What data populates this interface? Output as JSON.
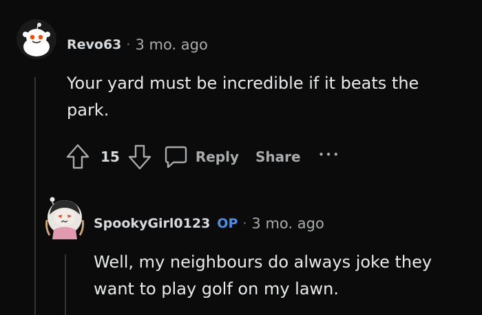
{
  "comments": [
    {
      "username": "Revo63",
      "separator": "·",
      "time": "3 mo. ago",
      "body_line1": "Your yard must be incredible if it beats the",
      "body_line2": "park.",
      "votes": "15",
      "reply_label": "Reply",
      "share_label": "Share",
      "more_label": "•••"
    },
    {
      "username": "SpookyGirl0123",
      "badge": "OP",
      "separator": "·",
      "time": "3 mo. ago",
      "body_line1": "Well, my neighbours do always joke they",
      "body_line2": "want to play golf on my lawn."
    }
  ],
  "colors": {
    "background": "#0b0b0b",
    "text": "#d7dadc",
    "muted": "#a9abad",
    "op_badge": "#4a8fe7",
    "thread_line": "#343536"
  }
}
